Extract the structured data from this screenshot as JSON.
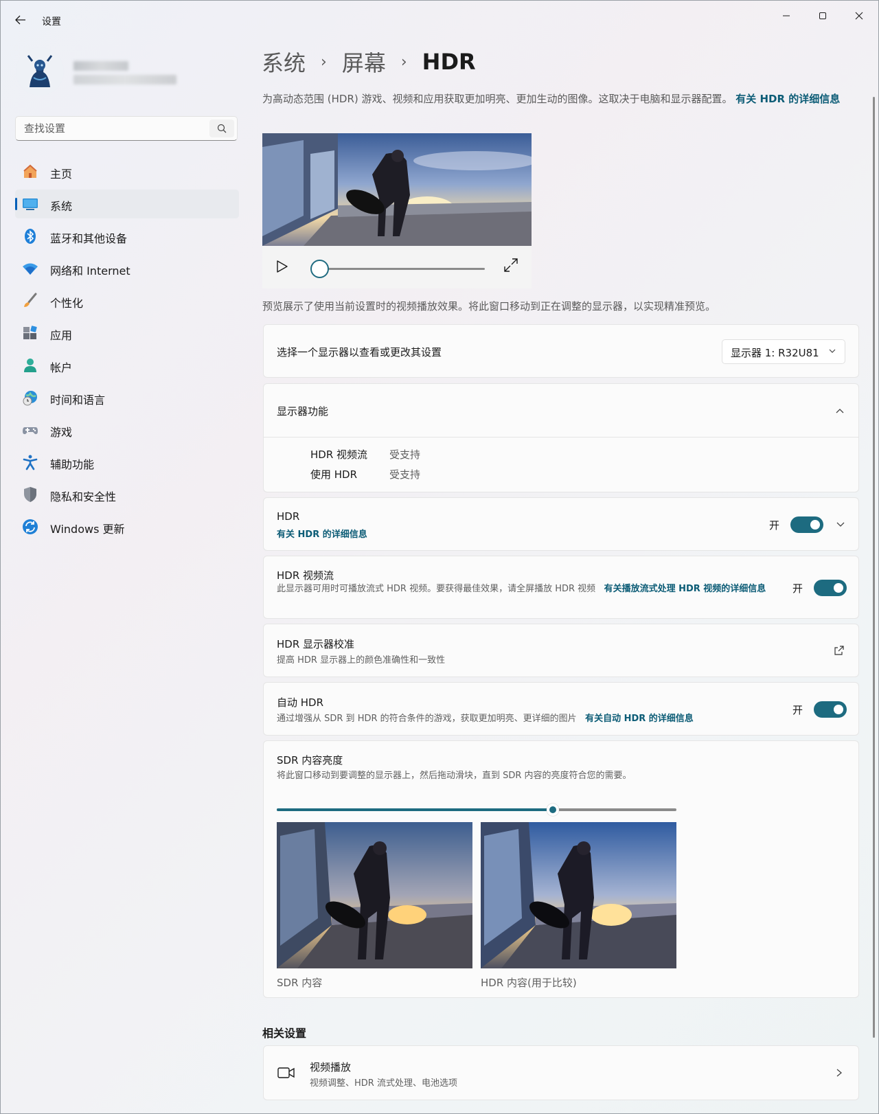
{
  "window": {
    "title": "设置"
  },
  "user": {
    "name": "",
    "email": ""
  },
  "search": {
    "placeholder": "查找设置"
  },
  "sidebar": {
    "items": [
      {
        "label": "主页",
        "icon": "home-icon"
      },
      {
        "label": "系统",
        "icon": "system-display-icon",
        "active": true
      },
      {
        "label": "蓝牙和其他设备",
        "icon": "bluetooth-icon"
      },
      {
        "label": "网络和 Internet",
        "icon": "wifi-icon"
      },
      {
        "label": "个性化",
        "icon": "paintbrush-icon"
      },
      {
        "label": "应用",
        "icon": "apps-icon"
      },
      {
        "label": "帐户",
        "icon": "account-icon"
      },
      {
        "label": "时间和语言",
        "icon": "globe-clock-icon"
      },
      {
        "label": "游戏",
        "icon": "gamepad-icon"
      },
      {
        "label": "辅助功能",
        "icon": "accessibility-icon"
      },
      {
        "label": "隐私和安全性",
        "icon": "shield-icon"
      },
      {
        "label": "Windows 更新",
        "icon": "update-icon"
      }
    ]
  },
  "breadcrumb": {
    "level1": "系统",
    "level2": "屏幕",
    "current": "HDR",
    "separator": "›"
  },
  "intro": {
    "text": "为高动态范围 (HDR) 游戏、视频和应用获取更加明亮、更加生动的图像。这取决于电脑和显示器配置。",
    "link": "有关 HDR 的详细信息"
  },
  "video_player": {
    "progress": 0.0
  },
  "preview_note": "预览展示了使用当前设置时的视频播放效果。将此窗口移动到正在调整的显示器，以实现精准预览。",
  "monitor_select": {
    "label": "选择一个显示器以查看或更改其设置",
    "selected": "显示器 1: R32U81"
  },
  "capabilities": {
    "title": "显示器功能",
    "rows": [
      {
        "name": "HDR 视频流",
        "value": "受支持"
      },
      {
        "name": "使用 HDR",
        "value": "受支持"
      }
    ]
  },
  "hdr": {
    "title": "HDR",
    "link": "有关 HDR 的详细信息",
    "state": "开",
    "on": true
  },
  "hdr_streaming": {
    "title": "HDR 视频流",
    "desc": "此显示器可用时可播放流式 HDR 视频。要获得最佳效果，请全屏播放 HDR 视频",
    "link": "有关播放流式处理 HDR 视频的详细信息",
    "state": "开",
    "on": true
  },
  "calibration": {
    "title": "HDR 显示器校准",
    "desc": "提高 HDR 显示器上的颜色准确性和一致性"
  },
  "auto_hdr": {
    "title": "自动 HDR",
    "desc": "通过增强从 SDR 到 HDR 的符合条件的游戏，获取更加明亮、更详细的图片",
    "link": "有关自动 HDR 的详细信息",
    "state": "开",
    "on": true
  },
  "sdr_brightness": {
    "title": "SDR 内容亮度",
    "desc": "将此窗口移动到要调整的显示器上，然后拖动滑块，直到 SDR 内容的亮度符合您的需要。",
    "value": 0.69,
    "left_label": "SDR 内容",
    "right_label": "HDR 内容(用于比较)"
  },
  "related": {
    "title": "相关设置",
    "video_playback": {
      "title": "视频播放",
      "desc": "视频调整、HDR 流式处理、电池选项"
    }
  },
  "colors": {
    "accent": "#1d6b80",
    "link": "#0c5c76",
    "nav_indicator": "#005fb8"
  }
}
